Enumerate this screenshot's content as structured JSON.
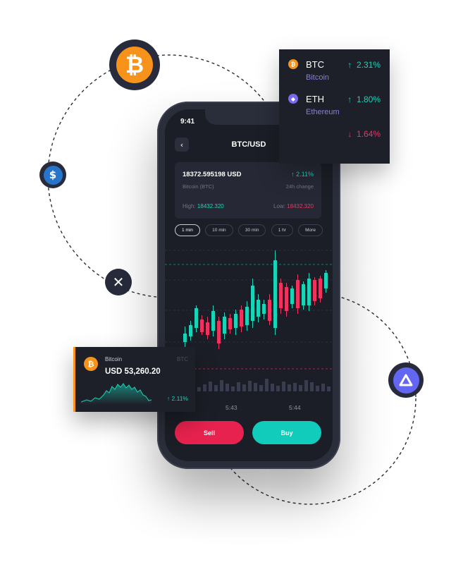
{
  "phone": {
    "status": {
      "time": "9:41"
    },
    "header": {
      "title": "BTC/USD",
      "back_icon": "chevron-left-icon",
      "refresh_icon": "refresh-icon"
    },
    "price_card": {
      "price": "18372.595198 USD",
      "change": "2.11%",
      "asset": "Bitcoin (BTC)",
      "change_label": "24h change",
      "high_label": "High:",
      "high_value": "18432.320",
      "low_label": "Low:",
      "low_value": "18432.320"
    },
    "intervals": [
      "1 min",
      "10 min",
      "30 min",
      "1 hr",
      "More"
    ],
    "active_interval": "1 min",
    "x_ticks": [
      "5:43",
      "5:44"
    ],
    "actions": {
      "sell": "Sell",
      "buy": "Buy"
    }
  },
  "market_list": [
    {
      "symbol": "BTC",
      "name": "Bitcoin",
      "change": "2.31%",
      "direction": "up",
      "icon": "bitcoin-icon",
      "color": "#f7931a"
    },
    {
      "symbol": "ETH",
      "name": "Ethereum",
      "change": "1.80%",
      "direction": "up",
      "icon": "ethereum-icon",
      "color": "#7b68ee"
    },
    {
      "symbol": "",
      "name": "",
      "change": "1.64%",
      "direction": "down",
      "icon": "",
      "color": ""
    }
  ],
  "bitcoin_card": {
    "name": "Bitcoin",
    "symbol": "BTC",
    "price": "USD 53,260.20",
    "change": "2.11%"
  },
  "coins": [
    "bitcoin-icon",
    "usd-coin-icon",
    "xrp-icon",
    "arweave-icon"
  ],
  "colors": {
    "up": "#18d4b8",
    "down": "#f0325f",
    "bitcoin": "#f7931a",
    "background_dark": "#1c1e27"
  }
}
